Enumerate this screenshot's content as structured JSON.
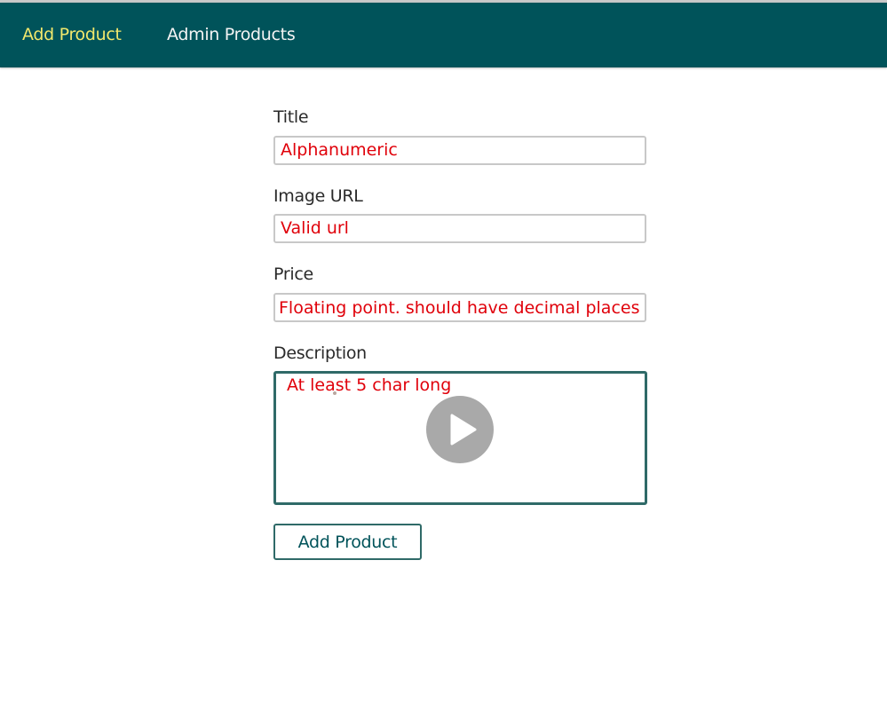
{
  "nav": {
    "add_product": "Add Product",
    "admin_products": "Admin Products",
    "active_color": "#f2e86c",
    "background": "#00535a"
  },
  "form": {
    "title_label": "Title",
    "title_hint": "Alphanumeric",
    "image_url_label": "Image URL",
    "image_url_hint": "Valid url",
    "price_label": "Price",
    "price_hint": "Floating point. should have decimal places",
    "description_label": "Description",
    "description_hint": "At least 5 char long",
    "submit_label": "Add Product"
  },
  "overlay": {
    "play_icon": "play-icon"
  },
  "colors": {
    "hint": "#e0000a",
    "accent": "#2f6a68"
  }
}
